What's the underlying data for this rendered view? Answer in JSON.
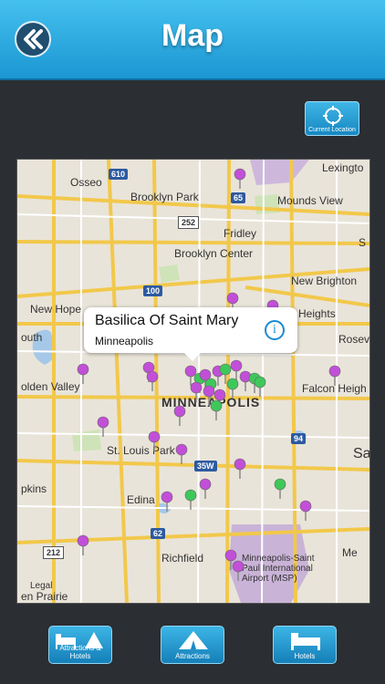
{
  "header": {
    "title": "Map"
  },
  "current_location": {
    "label": "Current Location"
  },
  "map": {
    "labels": [
      "Osseo",
      "Brooklyn Park",
      "Fridley",
      "Brooklyn Center",
      "Mounds View",
      "New Brighton",
      "New Hope",
      "Heights",
      "outh",
      "olden Valley",
      "MINNEAPOLIS",
      "Falcon Heigh",
      "Rosev",
      "St. Louis Park",
      "pkins",
      "Edina",
      "Richfield",
      "Minneapolis-Saint Paul International Airport (MSP)",
      "Legal",
      "en Prairie",
      "Lexingto",
      "S",
      "Sa",
      "Me"
    ],
    "highway_shields": [
      "610",
      "252",
      "65",
      "100",
      "35W",
      "94",
      "62",
      "212"
    ]
  },
  "callout": {
    "title": "Basilica Of Saint Mary",
    "subtitle": "Minneapolis"
  },
  "tabs": [
    {
      "label": "Attractions & Hotels"
    },
    {
      "label": "Attractions"
    },
    {
      "label": "Hotels"
    }
  ],
  "colors": {
    "header": "#2fb0e8",
    "pin_purple": "#c24fd8",
    "pin_green": "#3ec85a"
  }
}
